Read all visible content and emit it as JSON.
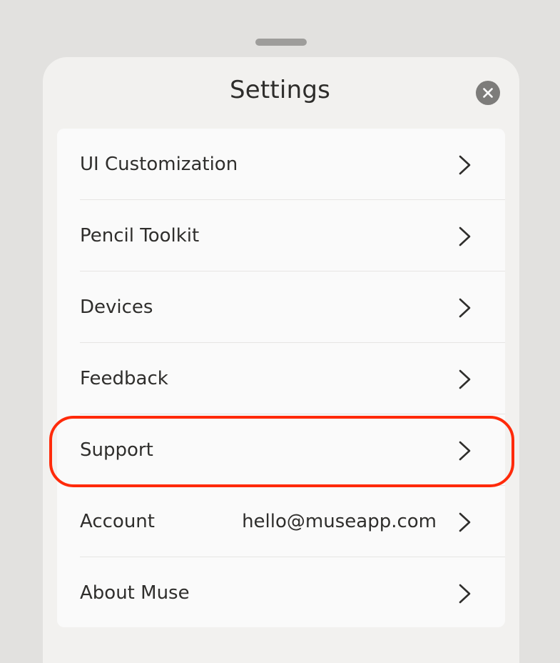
{
  "sheet": {
    "title": "Settings",
    "close_icon": "close-icon"
  },
  "settings": {
    "items": [
      {
        "label": "UI Customization",
        "value": ""
      },
      {
        "label": "Pencil Toolkit",
        "value": ""
      },
      {
        "label": "Devices",
        "value": ""
      },
      {
        "label": "Feedback",
        "value": ""
      },
      {
        "label": "Support",
        "value": ""
      },
      {
        "label": "Account",
        "value": "hello@museapp.com"
      },
      {
        "label": "About Muse",
        "value": ""
      }
    ]
  },
  "colors": {
    "highlight": "#ff2a0a",
    "background": "#e2e1df",
    "sheet": "#f2f1ef",
    "list": "#fafafa"
  }
}
